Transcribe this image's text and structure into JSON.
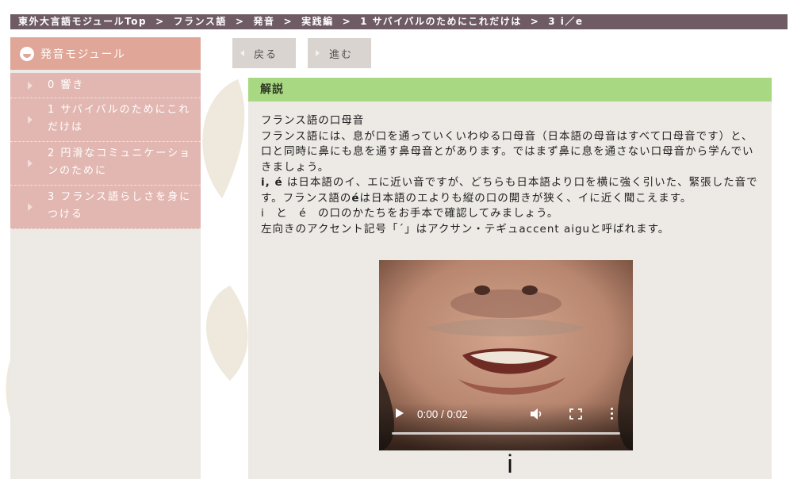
{
  "breadcrumb": {
    "items": [
      "東外大言語モジュールTop",
      "フランス語",
      "発音",
      "実践編",
      "1 サバイバルのためにこれだけは",
      "3 i／e"
    ],
    "separator": ">"
  },
  "sidebar": {
    "title": "発音モジュール",
    "items": [
      {
        "label": "0 響き"
      },
      {
        "label": "1 サバイバルのためにこれだけは"
      },
      {
        "label": "2 円滑なコミュニケーションのために"
      },
      {
        "label": "3 フランス語らしさを身につける"
      }
    ]
  },
  "nav": {
    "back_label": "戻る",
    "forward_label": "進む"
  },
  "panel": {
    "title": "解説",
    "lines": {
      "l1": "フランス語の口母音",
      "l2": "フランス語には、息が口を通っていくいわゆる口母音（日本語の母音はすべて口母音です）と、口と同時に鼻にも息を通す鼻母音とがあります。ではまず鼻に息を通さない口母音から学んでいきましょう。",
      "l3_strong": "i, é",
      "l3_rest": " は日本語のイ、エに近い音ですが、どちらも日本語より口を横に強く引いた、緊張した音です。フランス語の",
      "l3_strong2": "é",
      "l3_rest2": "は日本語のエよりも縦の口の開きが狭く、イに近く聞こえます。",
      "l4": "i　と　é　の口のかたちをお手本で確認してみましょう。",
      "l5": "左向きのアクセント記号「´」はアクサン・テギュaccent aiguと呼ばれます。"
    }
  },
  "video": {
    "time": "0:00 / 0:02",
    "caption": "i"
  },
  "colors": {
    "breadcrumb_bg": "#6e5b63",
    "sidebar_head": "#e0a697",
    "sidebar_list": "#e2b7b1",
    "panel_head": "#a9d882",
    "panel_bg": "#edeae5"
  }
}
